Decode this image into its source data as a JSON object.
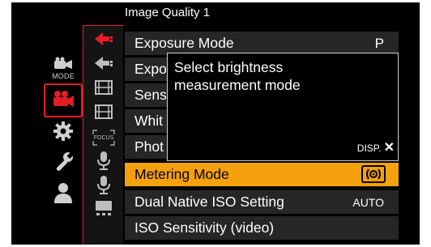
{
  "header": {
    "title": "Image Quality 1"
  },
  "categories": [
    {
      "name": "photo-video-mode",
      "label": "MODE",
      "icon": "camera-mode-icon"
    },
    {
      "name": "video",
      "label": "",
      "icon": "video-camera-icon",
      "selected": true
    },
    {
      "name": "custom",
      "label": "",
      "icon": "gear-icon"
    },
    {
      "name": "setup",
      "label": "",
      "icon": "wrench-icon"
    },
    {
      "name": "my-menu",
      "label": "",
      "icon": "person-icon"
    }
  ],
  "subtabs": {
    "focus_label": "FOCUS"
  },
  "menu": {
    "rows": [
      {
        "label": "Exposure Mode",
        "value": "P"
      },
      {
        "label": "Expo",
        "value": ""
      },
      {
        "label": "Sens",
        "value": ""
      },
      {
        "label": "Whit",
        "value": ""
      },
      {
        "label": "Phot",
        "value": ""
      },
      {
        "label": "Metering Mode",
        "value": "",
        "highlight": true
      },
      {
        "label": "Dual Native ISO Setting",
        "value": "AUTO"
      },
      {
        "label": "ISO Sensitivity (video)",
        "value": ""
      }
    ]
  },
  "tooltip": {
    "line1": "Select brightness",
    "line2": "measurement mode",
    "disp_label": "DISP."
  },
  "colors": {
    "accent": "#e51c24",
    "highlight": "#f5a10e",
    "row_bg": "#262626"
  }
}
